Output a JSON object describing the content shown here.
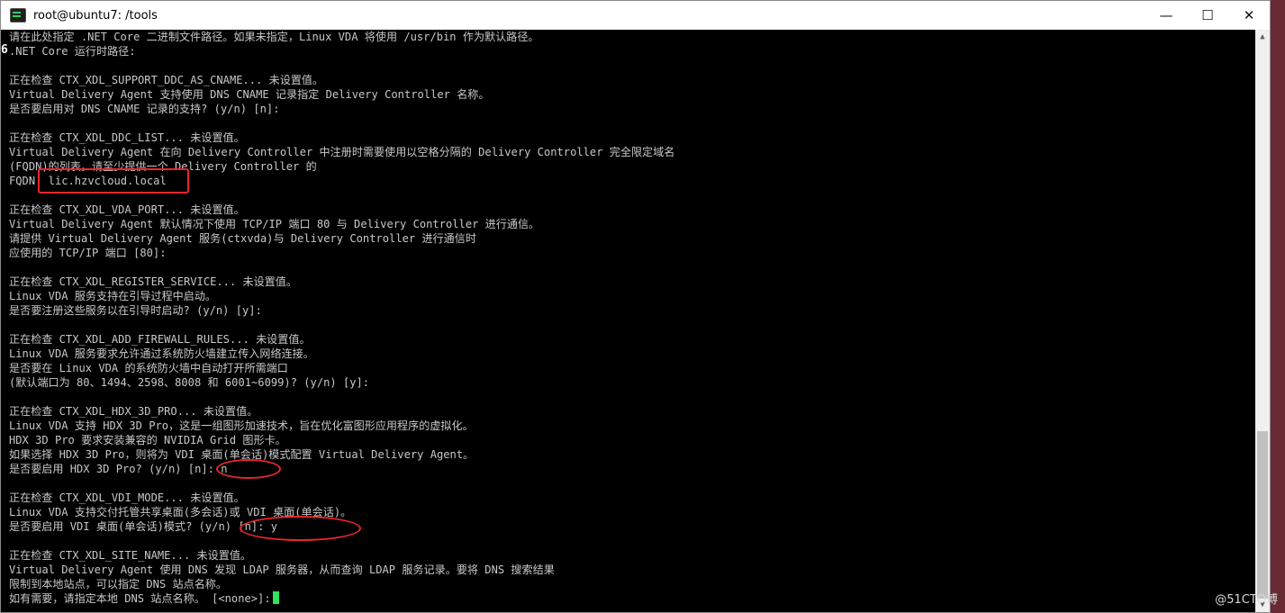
{
  "window": {
    "title": "root@ubuntu7: /tools",
    "minimize": "—",
    "maximize": "☐",
    "close": "✕"
  },
  "terminal": {
    "overflow_digit": "6",
    "lines": [
      "请在此处指定 .NET Core 二进制文件路径。如果未指定，Linux VDA 将使用 /usr/bin 作为默认路径。",
      ".NET Core 运行时路径:",
      "",
      "正在检查 CTX_XDL_SUPPORT_DDC_AS_CNAME... 未设置值。",
      "Virtual Delivery Agent 支持使用 DNS CNAME 记录指定 Delivery Controller 名称。",
      "是否要启用对 DNS CNAME 记录的支持? (y/n) [n]:",
      "",
      "正在检查 CTX_XDL_DDC_LIST... 未设置值。",
      "Virtual Delivery Agent 在向 Delivery Controller 中注册时需要使用以空格分隔的 Delivery Controller 完全限定域名",
      "(FQDN)的列表。请至少提供一个 Delivery Controller 的",
      "FQDN: lic.hzvcloud.local",
      "",
      "正在检查 CTX_XDL_VDA_PORT... 未设置值。",
      "Virtual Delivery Agent 默认情况下使用 TCP/IP 端口 80 与 Delivery Controller 进行通信。",
      "请提供 Virtual Delivery Agent 服务(ctxvda)与 Delivery Controller 进行通信时",
      "应使用的 TCP/IP 端口 [80]:",
      "",
      "正在检查 CTX_XDL_REGISTER_SERVICE... 未设置值。",
      "Linux VDA 服务支持在引导过程中启动。",
      "是否要注册这些服务以在引导时启动? (y/n) [y]:",
      "",
      "正在检查 CTX_XDL_ADD_FIREWALL_RULES... 未设置值。",
      "Linux VDA 服务要求允许通过系统防火墙建立传入网络连接。",
      "是否要在 Linux VDA 的系统防火墙中自动打开所需端口",
      "(默认端口为 80、1494、2598、8008 和 6001~6099)? (y/n) [y]:",
      "",
      "正在检查 CTX_XDL_HDX_3D_PRO... 未设置值。",
      "Linux VDA 支持 HDX 3D Pro，这是一组图形加速技术，旨在优化富图形应用程序的虚拟化。",
      "HDX 3D Pro 要求安装兼容的 NVIDIA Grid 图形卡。",
      "如果选择 HDX 3D Pro，则将为 VDI 桌面(单会话)模式配置 Virtual Delivery Agent。",
      "是否要启用 HDX 3D Pro? (y/n) [n]: n",
      "",
      "正在检查 CTX_XDL_VDI_MODE... 未设置值。",
      "Linux VDA 支持交付托管共享桌面(多会话)或 VDI 桌面(单会话)。",
      "是否要启用 VDI 桌面(单会话)模式? (y/n) [n]: y",
      "",
      "正在检查 CTX_XDL_SITE_NAME... 未设置值。",
      "Virtual Delivery Agent 使用 DNS 发现 LDAP 服务器，从而查询 LDAP 服务记录。要将 DNS 搜索结果",
      "限制到本地站点，可以指定 DNS 站点名称。",
      "如有需要，请指定本地 DNS 站点名称。 [<none>]:"
    ]
  },
  "scrollbar": {
    "up_arrow": "▲",
    "down_arrow": "▼"
  },
  "watermark": "@51CTO博",
  "colors": {
    "terminal_bg": "#000000",
    "terminal_text": "#c8c8c8",
    "cursor": "#31e35a",
    "annotation": "#e8262b",
    "desktop": "#6a2a33"
  }
}
